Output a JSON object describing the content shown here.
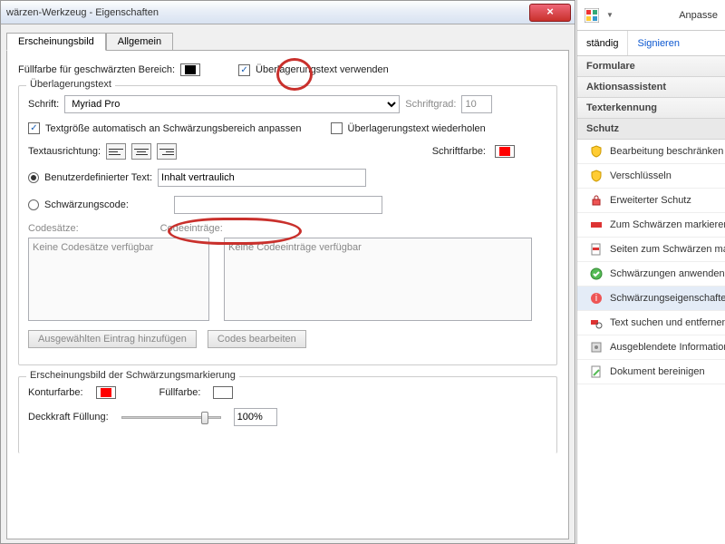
{
  "dialog": {
    "title": "wärzen-Werkzeug - Eigenschaften",
    "tabs": {
      "appearance": "Erscheinungsbild",
      "general": "Allgemein"
    },
    "fillLabel": "Füllfarbe für geschwärzten Bereich:",
    "fillColor": "#000000",
    "overlayCheck": "Überlagerungstext verwenden",
    "overlay": {
      "legend": "Überlagerungstext",
      "fontLabel": "Schrift:",
      "fontValue": "Myriad Pro",
      "sizeLabel": "Schriftgrad:",
      "sizeValue": "10",
      "autoSize": "Textgröße automatisch an Schwärzungsbereich anpassen",
      "repeat": "Überlagerungstext wiederholen",
      "alignLabel": "Textausrichtung:",
      "fontColorLabel": "Schriftfarbe:",
      "fontColor": "#ff0000",
      "customTextLabel": "Benutzerdefinierter Text:",
      "customTextValue": "Inhalt vertraulich",
      "codeLabel": "Schwärzungscode:",
      "codesetsLabel": "Codesätze:",
      "codeentriesLabel": "Codeeinträge:",
      "noCodesets": "Keine Codesätze verfügbar",
      "noCodeentries": "Keine Codeeinträge verfügbar",
      "addEntryBtn": "Ausgewählten Eintrag hinzufügen",
      "editCodesBtn": "Codes bearbeiten"
    },
    "mark": {
      "legend": "Erscheinungsbild der Schwärzungsmarkierung",
      "outlineLabel": "Konturfarbe:",
      "outlineColor": "#ff0000",
      "fillLabel": "Füllfarbe:",
      "opacityLabel": "Deckkraft Füllung:",
      "opacityValue": "100%"
    }
  },
  "right": {
    "customize": "Anpasse",
    "tabs": {
      "full": "ständig",
      "sign": "Signieren"
    },
    "sections": {
      "forms": "Formulare",
      "actions": "Aktionsassistent",
      "ocr": "Texterkennung",
      "protect": "Schutz"
    },
    "items": {
      "restrict": "Bearbeitung beschränken",
      "encrypt": "Verschlüsseln",
      "extended": "Erweiterter Schutz",
      "markRedact": "Zum Schwärzen markieren",
      "markPages": "Seiten zum Schwärzen mark",
      "apply": "Schwärzungen anwenden",
      "props": "Schwärzungseigenschaften",
      "search": "Text suchen und entfernen",
      "hidden": "Ausgeblendete Information",
      "sanitize": "Dokument bereinigen"
    }
  }
}
